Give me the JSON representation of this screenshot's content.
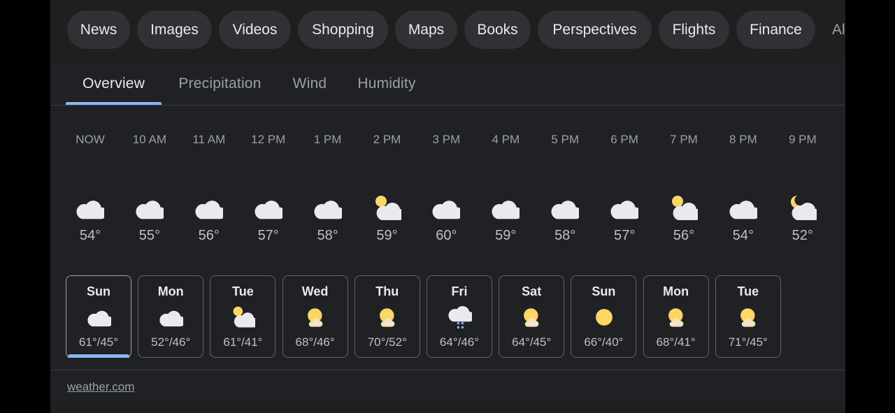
{
  "chips": [
    "News",
    "Images",
    "Videos",
    "Shopping",
    "Maps",
    "Books",
    "Perspectives",
    "Flights",
    "Finance",
    "Al"
  ],
  "tabs": [
    "Overview",
    "Precipitation",
    "Wind",
    "Humidity"
  ],
  "hourly": [
    {
      "time": "NOW",
      "temp": "54°",
      "icon": "cloudy-icon"
    },
    {
      "time": "10 AM",
      "temp": "55°",
      "icon": "cloudy-icon"
    },
    {
      "time": "11 AM",
      "temp": "56°",
      "icon": "cloudy-icon"
    },
    {
      "time": "12 PM",
      "temp": "57°",
      "icon": "cloudy-icon"
    },
    {
      "time": "1 PM",
      "temp": "58°",
      "icon": "cloudy-icon"
    },
    {
      "time": "2 PM",
      "temp": "59°",
      "icon": "partly-sunny-icon"
    },
    {
      "time": "3 PM",
      "temp": "60°",
      "icon": "cloudy-icon"
    },
    {
      "time": "4 PM",
      "temp": "59°",
      "icon": "cloudy-icon"
    },
    {
      "time": "5 PM",
      "temp": "58°",
      "icon": "cloudy-icon"
    },
    {
      "time": "6 PM",
      "temp": "57°",
      "icon": "cloudy-icon"
    },
    {
      "time": "7 PM",
      "temp": "56°",
      "icon": "partly-sunny-icon"
    },
    {
      "time": "8 PM",
      "temp": "54°",
      "icon": "cloudy-icon"
    },
    {
      "time": "9 PM",
      "temp": "52°",
      "icon": "partly-cloudy-night-icon"
    }
  ],
  "daily": [
    {
      "day": "Sun",
      "temps": "61°/45°",
      "icon": "cloudy-icon"
    },
    {
      "day": "Mon",
      "temps": "52°/46°",
      "icon": "cloudy-icon"
    },
    {
      "day": "Tue",
      "temps": "61°/41°",
      "icon": "partly-cloudy-icon"
    },
    {
      "day": "Wed",
      "temps": "68°/46°",
      "icon": "mostly-sunny-icon"
    },
    {
      "day": "Thu",
      "temps": "70°/52°",
      "icon": "mostly-sunny-icon"
    },
    {
      "day": "Fri",
      "temps": "64°/46°",
      "icon": "rain-icon"
    },
    {
      "day": "Sat",
      "temps": "64°/45°",
      "icon": "mostly-sunny-icon"
    },
    {
      "day": "Sun",
      "temps": "66°/40°",
      "icon": "sunny-icon"
    },
    {
      "day": "Mon",
      "temps": "68°/41°",
      "icon": "mostly-sunny-icon"
    },
    {
      "day": "Tue",
      "temps": "71°/45°",
      "icon": "mostly-sunny-icon"
    }
  ],
  "source": "weather.com",
  "colors": {
    "accent": "#8ab4f8",
    "sun": "#fdd663",
    "cloud": "#e8eaed",
    "rain": "#8ab4f8"
  }
}
